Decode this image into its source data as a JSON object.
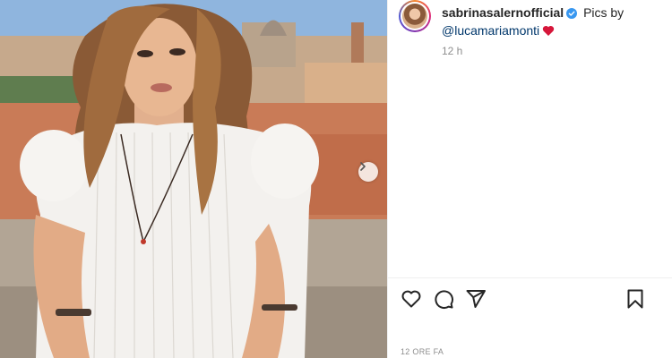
{
  "post": {
    "username": "sabrinasalernofficial",
    "caption_prefix": "Pics by",
    "mention": "@lucamariamonti",
    "relative_time": "12 h",
    "date_label": "12 ORE FA"
  },
  "icons": {
    "verified": "verified-badge-icon",
    "heart_emoji": "red-heart-icon",
    "next": "chevron-right-icon",
    "like": "heart-outline-icon",
    "comment": "comment-icon",
    "share": "paper-plane-icon",
    "save": "bookmark-icon"
  },
  "colors": {
    "verified_blue": "#3897f0",
    "mention_blue": "#00376b",
    "heart_red": "#d6163a",
    "muted_text": "#8e8e8e"
  }
}
